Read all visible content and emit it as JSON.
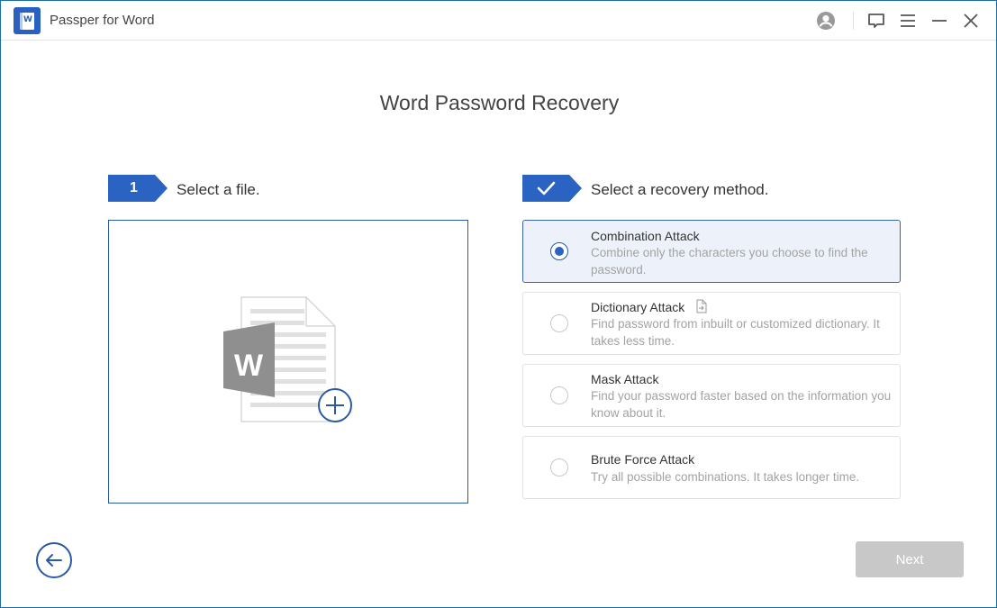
{
  "app": {
    "title": "Passper for Word",
    "logo_letter": "W"
  },
  "titlebar_icons": [
    "account-icon",
    "feedback-icon",
    "menu-icon",
    "minimize-icon",
    "close-icon"
  ],
  "page": {
    "title": "Word Password Recovery"
  },
  "step1": {
    "badge": "1",
    "label": "Select a file.",
    "drop_icon_letter": "W"
  },
  "step2": {
    "badge_icon": "check-icon",
    "label": "Select a recovery method."
  },
  "methods": [
    {
      "name": "Combination Attack",
      "desc": "Combine only the characters you choose to find the password.",
      "selected": true
    },
    {
      "name": "Dictionary Attack",
      "desc": "Find password from inbuilt or customized dictionary. It takes less time.",
      "selected": false,
      "extra_icon": "import-file-icon"
    },
    {
      "name": "Mask Attack",
      "desc": "Find your password faster based on the information you know about it.",
      "selected": false
    },
    {
      "name": "Brute Force Attack",
      "desc": "Try all possible combinations. It takes longer time.",
      "selected": false
    }
  ],
  "footer": {
    "next_label": "Next",
    "next_enabled": false
  },
  "colors": {
    "accent": "#2a63c1",
    "selected_bg": "#edf2fa",
    "disabled_button": "#c8c8c8",
    "window_border": "#1e6ea6"
  }
}
